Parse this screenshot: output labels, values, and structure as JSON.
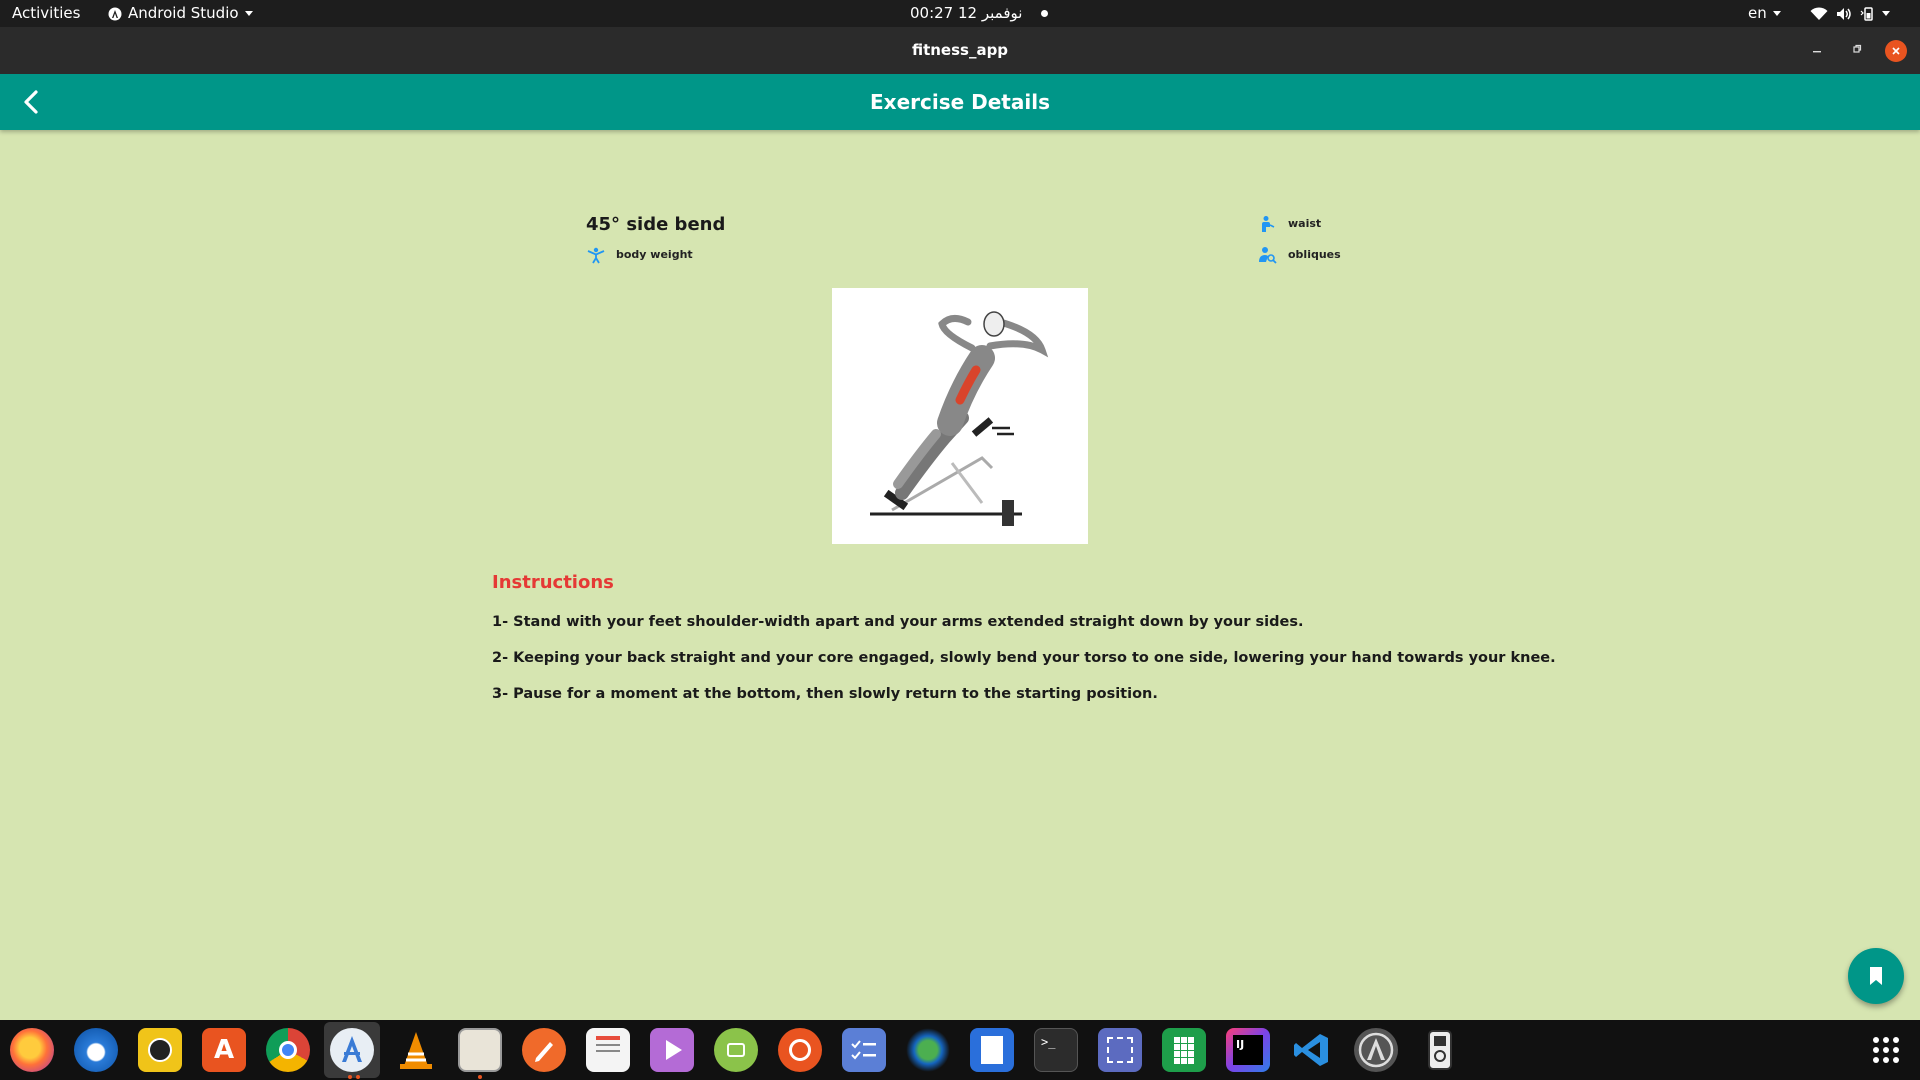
{
  "topbar": {
    "activities": "Activities",
    "app_menu": "Android Studio",
    "clock": "00:27  12 نوفمبر",
    "language": "en"
  },
  "window": {
    "title": "fitness_app"
  },
  "appbar": {
    "title": "Exercise Details"
  },
  "exercise": {
    "name": "45° side bend",
    "equipment": "body weight",
    "body_part": "waist",
    "target": "obliques"
  },
  "instructions": {
    "heading": "Instructions",
    "steps": [
      "1- Stand with your feet shoulder-width apart and your arms extended straight down by your sides.",
      "2- Keeping your back straight and your core engaged, slowly bend your torso to one side, lowering your hand towards your knee.",
      "3- Pause for a moment at the bottom, then slowly return to the starting position."
    ]
  },
  "colors": {
    "appbar": "#009688",
    "background": "#d6e5b1",
    "instructions_heading": "#e53935",
    "chip_icon": "#2196f3"
  },
  "icons": {
    "back": "arrow-back-icon",
    "equipment": "body-weight-icon",
    "body_part": "person-icon",
    "target": "person-search-icon",
    "fab": "bookmark-icon"
  },
  "dock": [
    "firefox-icon",
    "thunderbird-icon",
    "rhythmbox-icon",
    "software-center-icon",
    "chrome-icon",
    "android-studio-icon",
    "vlc-icon",
    "files-icon",
    "inkscape-icon",
    "document-viewer-icon",
    "video-player-icon",
    "archive-manager-icon",
    "ubuntu-icon",
    "tasks-icon",
    "camera-icon",
    "writer-icon",
    "terminal-icon",
    "screenshot-icon",
    "calc-icon",
    "intellij-icon",
    "vscode-icon",
    "software-updater-icon",
    "ipod-icon",
    "app-grid-icon"
  ]
}
